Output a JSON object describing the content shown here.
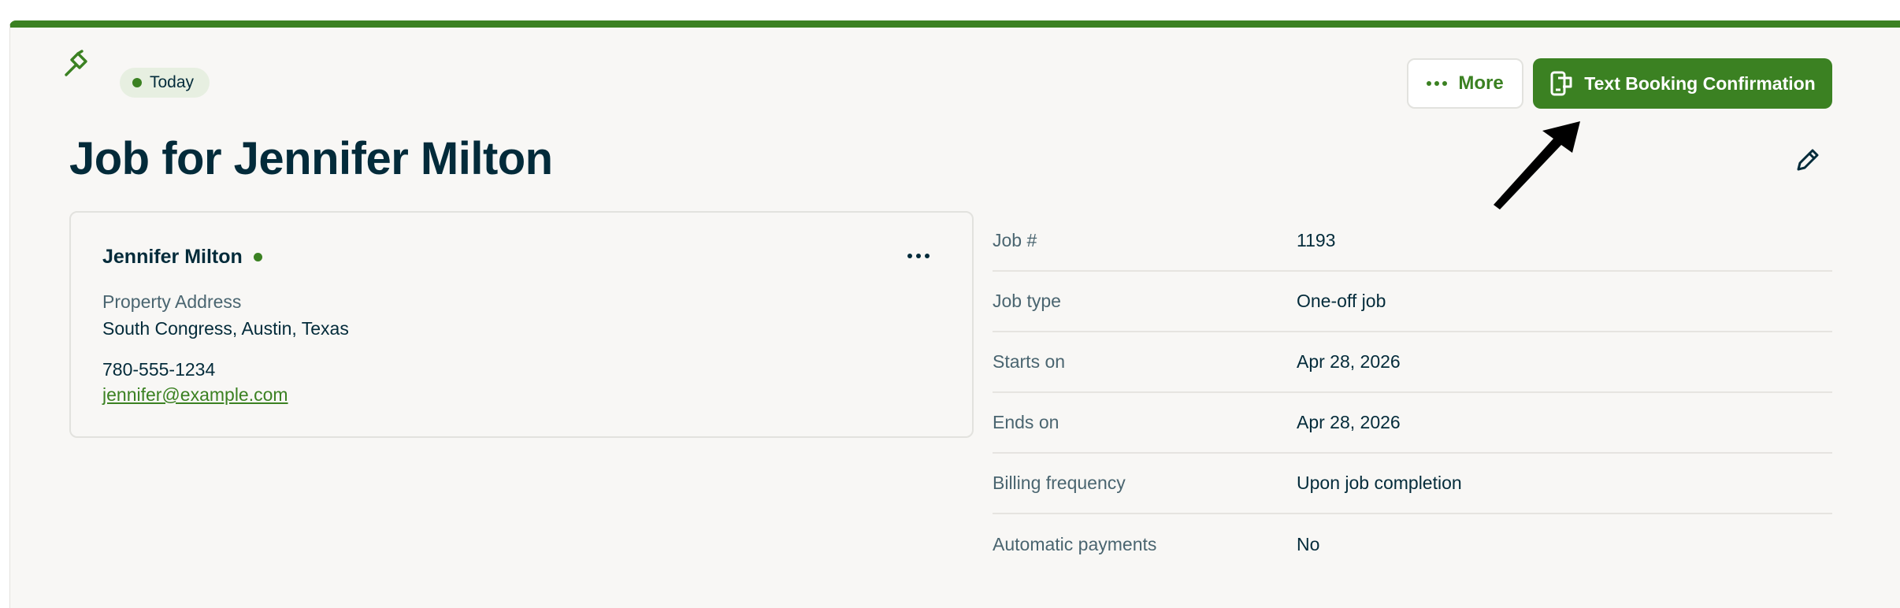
{
  "header": {
    "badge_label": "Today",
    "more_label": "More",
    "primary_action_label": "Text Booking Confirmation",
    "page_title": "Job for Jennifer Milton"
  },
  "client": {
    "name": "Jennifer Milton",
    "property_label": "Property Address",
    "property_value": "South Congress, Austin, Texas",
    "phone": "780-555-1234",
    "email": "jennifer@example.com"
  },
  "details": [
    {
      "label": "Job #",
      "value": "1193"
    },
    {
      "label": "Job type",
      "value": "One-off job"
    },
    {
      "label": "Starts on",
      "value": "Apr 28, 2026"
    },
    {
      "label": "Ends on",
      "value": "Apr 28, 2026"
    },
    {
      "label": "Billing frequency",
      "value": "Upon job completion"
    },
    {
      "label": "Automatic payments",
      "value": "No"
    }
  ],
  "colors": {
    "brand_green": "#3b8122",
    "title_navy": "#032b3a",
    "background": "#f8f7f5"
  },
  "icons": {
    "job": "hammer-icon",
    "action": "mobile-message-icon",
    "edit": "pencil-icon",
    "annotation": "arrow-pointer"
  }
}
